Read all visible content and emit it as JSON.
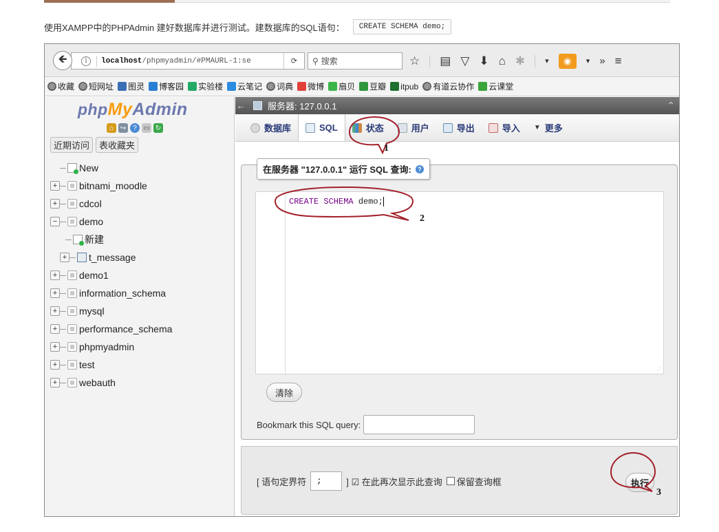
{
  "intro": {
    "text": "使用XAMPP中的PHPAdmin 建好数据库并进行测试。建数据库的SQL语句：",
    "code": "CREATE SCHEMA demo;"
  },
  "browser": {
    "url_host": "localhost",
    "url_path": "/phpmyadmin/#PMAURL-1:se",
    "search_placeholder": "搜索",
    "toolbar_icons": [
      "star-icon",
      "reading-list-icon",
      "pocket-icon",
      "download-icon",
      "home-icon",
      "extension-icon",
      "tampermonkey-icon",
      "overflow-icon",
      "menu-icon"
    ]
  },
  "bookmarks": [
    {
      "label": "收藏",
      "icon": "globe-icon",
      "color": "#666666"
    },
    {
      "label": "短网址",
      "icon": "globe-icon",
      "color": "#666666"
    },
    {
      "label": "图灵",
      "icon": "book-icon",
      "color": "#3a6fb5"
    },
    {
      "label": "博客园",
      "icon": "blog-icon",
      "color": "#2a7fd4"
    },
    {
      "label": "实验楼",
      "icon": "leaf-icon",
      "color": "#22aa66"
    },
    {
      "label": "云笔记",
      "icon": "note-icon",
      "color": "#2b8be0"
    },
    {
      "label": "词典",
      "icon": "globe-icon",
      "color": "#666666"
    },
    {
      "label": "微博",
      "icon": "weibo-icon",
      "color": "#e2413a"
    },
    {
      "label": "扇贝",
      "icon": "shanbay-icon",
      "color": "#3bb54a"
    },
    {
      "label": "豆瓣",
      "icon": "douban-icon",
      "color": "#2e963d"
    },
    {
      "label": "itpub",
      "icon": "itpub-icon",
      "color": "#1f6f2f"
    },
    {
      "label": "有道云协作",
      "icon": "globe-icon",
      "color": "#666666"
    },
    {
      "label": "云课堂",
      "icon": "cloud-class-icon",
      "color": "#3aa43a"
    }
  ],
  "sidebar": {
    "logo": {
      "php": "php",
      "my": "My",
      "admin": "Admin"
    },
    "tabs": [
      "近期访问",
      "表收藏夹"
    ],
    "tree": [
      {
        "label": "New",
        "type": "new"
      },
      {
        "label": "bitnami_moodle",
        "type": "db"
      },
      {
        "label": "cdcol",
        "type": "db"
      },
      {
        "label": "demo",
        "type": "db-open"
      },
      {
        "label": "新建",
        "type": "child-new"
      },
      {
        "label": "t_message",
        "type": "child-table"
      },
      {
        "label": "demo1",
        "type": "db"
      },
      {
        "label": "information_schema",
        "type": "db"
      },
      {
        "label": "mysql",
        "type": "db"
      },
      {
        "label": "performance_schema",
        "type": "db"
      },
      {
        "label": "phpmyadmin",
        "type": "db"
      },
      {
        "label": "test",
        "type": "db"
      },
      {
        "label": "webauth",
        "type": "db"
      }
    ]
  },
  "main": {
    "server": "服务器: 127.0.0.1",
    "tabs": [
      {
        "label": "数据库",
        "icon": "database-icon"
      },
      {
        "label": "SQL",
        "icon": "sql-icon",
        "active": true
      },
      {
        "label": "状态",
        "icon": "status-icon"
      },
      {
        "label": "用户",
        "icon": "users-icon"
      },
      {
        "label": "导出",
        "icon": "export-icon"
      },
      {
        "label": "导入",
        "icon": "import-icon"
      },
      {
        "label": "更多",
        "icon": "more-icon"
      }
    ],
    "legend": "在服务器 \"127.0.0.1\" 运行 SQL 查询:",
    "sql_keyword": "CREATE SCHEMA",
    "sql_rest": " demo;",
    "clear_button": "清除",
    "bookmark_label": "Bookmark this SQL query:",
    "delimiter_label": "[ 语句定界符",
    "delimiter_value": ";",
    "show_again_label": "] ☑ 在此再次显示此查询",
    "retain_label": "保留查询框",
    "go_button": "执行"
  },
  "callouts": [
    "1",
    "2",
    "3"
  ],
  "colors": {
    "callout": "#a3202a",
    "pma_nav": "#2a3b78",
    "logo_orange": "#f89c0e",
    "logo_blue": "#6c78af"
  }
}
